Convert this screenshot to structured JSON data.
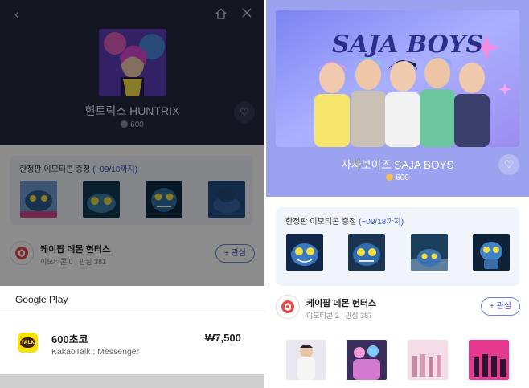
{
  "left": {
    "header": {
      "back_icon": "chevron-left-icon",
      "home_icon": "home-icon",
      "close_icon": "close-icon"
    },
    "product": {
      "title": "헌트릭스 HUNTRIX",
      "price": "600",
      "heart_icon": "heart-outline-icon"
    },
    "promo": {
      "title": "한정판 이모티콘 증정",
      "period": "(~09/18까지)",
      "thumbnails": [
        "emoticon-thumb-1",
        "emoticon-thumb-2",
        "emoticon-thumb-3",
        "emoticon-thumb-4"
      ]
    },
    "brand": {
      "name": "케이팝 데몬 헌터스",
      "emoticon_count": "이모티콘 0",
      "interest_count": "관심 381",
      "follow_label": "+ 관심"
    },
    "purchase_sheet": {
      "store_label": "Google Play",
      "item_name": "600초코",
      "item_app": "KakaoTalk : Messenger",
      "item_price": "₩7,500",
      "app_icon_text": "TALK"
    }
  },
  "right": {
    "product": {
      "title": "사자보이즈 SAJA BOYS",
      "price": "600",
      "cover_text": "SAJA BOYS",
      "heart_icon": "heart-outline-icon"
    },
    "promo": {
      "title": "한정판 이모티콘 증정",
      "period": "(~09/18까지)",
      "thumbnails": [
        "emoticon-thumb-1",
        "emoticon-thumb-2",
        "emoticon-thumb-3",
        "emoticon-thumb-4"
      ]
    },
    "brand": {
      "name": "케이팝 데몬 헌터스",
      "emoticon_count": "이모티콘 2",
      "interest_count": "관심 387",
      "follow_label": "+ 관심"
    },
    "emoticon_grid": [
      "preview-1",
      "preview-2",
      "preview-3",
      "preview-4"
    ]
  },
  "colors": {
    "accent_blue": "#3a56c8",
    "kakao_yellow": "#fae100",
    "coin_gold": "#f2c14e",
    "hero_purple": "#9ba2ef"
  }
}
